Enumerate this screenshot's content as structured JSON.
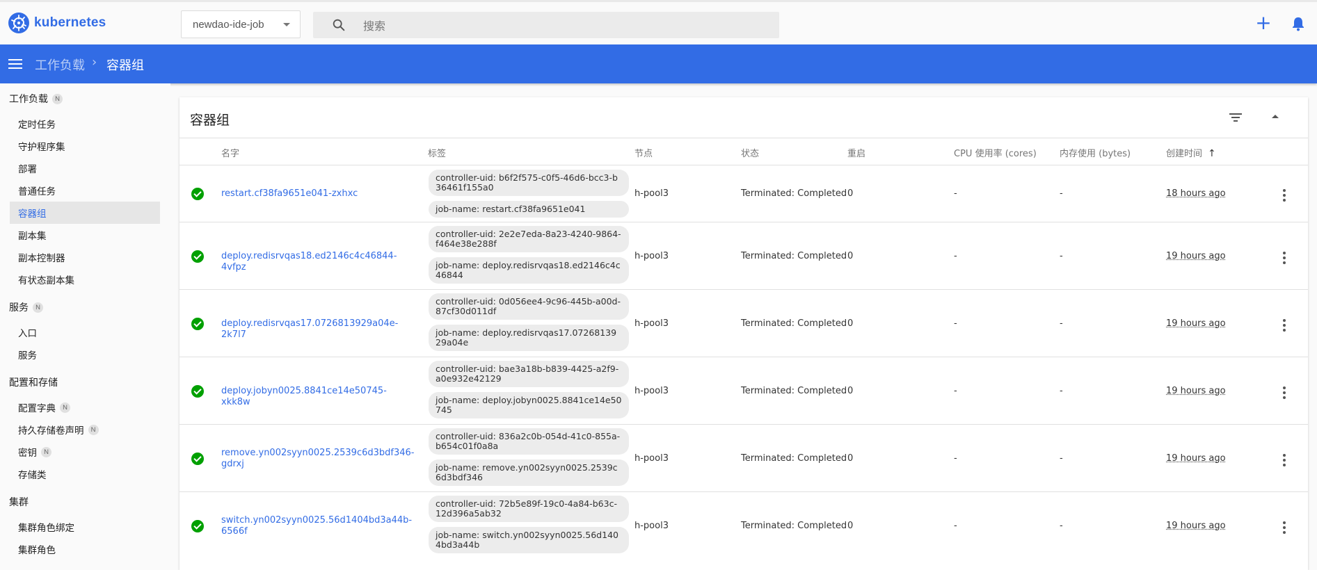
{
  "header": {
    "brand": "kubernetes",
    "namespace": "newdao-ide-job",
    "search_placeholder": "搜索"
  },
  "breadcrumb": {
    "parent": "工作负载",
    "separator": "›",
    "current": "容器组"
  },
  "sidebar": {
    "sections": [
      {
        "label": "工作负载",
        "badge": "N"
      },
      {
        "label": "服务",
        "badge": "N"
      },
      {
        "label": "配置和存储",
        "badge": ""
      },
      {
        "label": "集群",
        "badge": ""
      }
    ],
    "items": [
      {
        "label": "定时任务",
        "badge": ""
      },
      {
        "label": "守护程序集",
        "badge": ""
      },
      {
        "label": "部署",
        "badge": ""
      },
      {
        "label": "普通任务",
        "badge": ""
      },
      {
        "label": "容器组",
        "badge": "",
        "active": true
      },
      {
        "label": "副本集",
        "badge": ""
      },
      {
        "label": "副本控制器",
        "badge": ""
      },
      {
        "label": "有状态副本集",
        "badge": ""
      },
      {
        "label": "入口",
        "badge": ""
      },
      {
        "label": "服务",
        "badge": ""
      },
      {
        "label": "配置字典",
        "badge": "N"
      },
      {
        "label": "持久存储卷声明",
        "badge": "N"
      },
      {
        "label": "密钥",
        "badge": "N"
      },
      {
        "label": "存储类",
        "badge": ""
      },
      {
        "label": "集群角色绑定",
        "badge": ""
      },
      {
        "label": "集群角色",
        "badge": ""
      }
    ]
  },
  "card": {
    "title": "容器组",
    "columns": [
      "名字",
      "标签",
      "节点",
      "状态",
      "重启",
      "CPU 使用率 (cores)",
      "内存使用 (bytes)",
      "创建时间"
    ],
    "sort_indicator": "↑"
  },
  "pods": [
    {
      "name": "restart.cf38fa9651e041-zxhxc",
      "label1": "controller-uid: b6f2f575-c0f5-46d6-bcc3-b36461f155a0",
      "label2": "job-name: restart.cf38fa9651e041",
      "node": "h-pool3",
      "status": "Terminated: Completed",
      "restarts": "0",
      "cpu": "-",
      "memory": "-",
      "created": "18 hours ago"
    },
    {
      "name": "deploy.redisrvqas18.ed2146c4c46844-4vfpz",
      "label1": "controller-uid: 2e2e7eda-8a23-4240-9864-f464e38e288f",
      "label2": "job-name: deploy.redisrvqas18.ed2146c4c46844",
      "node": "h-pool3",
      "status": "Terminated: Completed",
      "restarts": "0",
      "cpu": "-",
      "memory": "-",
      "created": "19 hours ago"
    },
    {
      "name": "deploy.redisrvqas17.0726813929a04e-2k7l7",
      "label1": "controller-uid: 0d056ee4-9c96-445b-a00d-87cf30d011df",
      "label2": "job-name: deploy.redisrvqas17.0726813929a04e",
      "node": "h-pool3",
      "status": "Terminated: Completed",
      "restarts": "0",
      "cpu": "-",
      "memory": "-",
      "created": "19 hours ago"
    },
    {
      "name": "deploy.jobyn0025.8841ce14e50745-xkk8w",
      "label1": "controller-uid: bae3a18b-b839-4425-a2f9-a0e932e42129",
      "label2": "job-name: deploy.jobyn0025.8841ce14e50745",
      "node": "h-pool3",
      "status": "Terminated: Completed",
      "restarts": "0",
      "cpu": "-",
      "memory": "-",
      "created": "19 hours ago"
    },
    {
      "name": "remove.yn002syyn0025.2539c6d3bdf346-gdrxj",
      "label1": "controller-uid: 836a2c0b-054d-41c0-855a-b654c01f0a8a",
      "label2": "job-name: remove.yn002syyn0025.2539c6d3bdf346",
      "node": "h-pool3",
      "status": "Terminated: Completed",
      "restarts": "0",
      "cpu": "-",
      "memory": "-",
      "created": "19 hours ago"
    },
    {
      "name": "switch.yn002syyn0025.56d1404bd3a44b-6566f",
      "label1": "controller-uid: 72b5e89f-19c0-4a84-b63c-12d396a5ab32",
      "label2": "job-name: switch.yn002syyn0025.56d1404bd3a44b",
      "node": "h-pool3",
      "status": "Terminated: Completed",
      "restarts": "0",
      "cpu": "-",
      "memory": "-",
      "created": "19 hours ago"
    }
  ],
  "colors": {
    "primary": "#326ce5",
    "success": "#00a000"
  }
}
